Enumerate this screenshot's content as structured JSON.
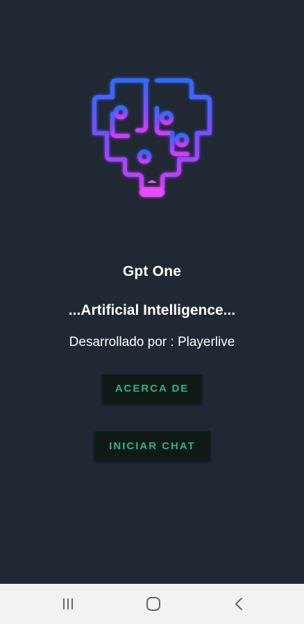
{
  "app": {
    "title": "Gpt One",
    "tagline": "...Artificial Intelligence...",
    "developer": "Desarrollado por : Playerlive",
    "logo_icon": "brain-circuit-icon"
  },
  "buttons": {
    "about_label": "ACERCA DE",
    "start_chat_label": "INICIAR CHAT"
  },
  "navbar": {
    "recents_icon": "recents-icon",
    "home_icon": "home-icon",
    "back_icon": "back-icon"
  },
  "colors": {
    "background": "#202833",
    "button_background": "#0f1a17",
    "button_text": "#2fb386",
    "logo_gradient_top": "#2f6bff",
    "logo_gradient_bottom": "#d13cff",
    "navbar_background": "#f2f2f2"
  }
}
